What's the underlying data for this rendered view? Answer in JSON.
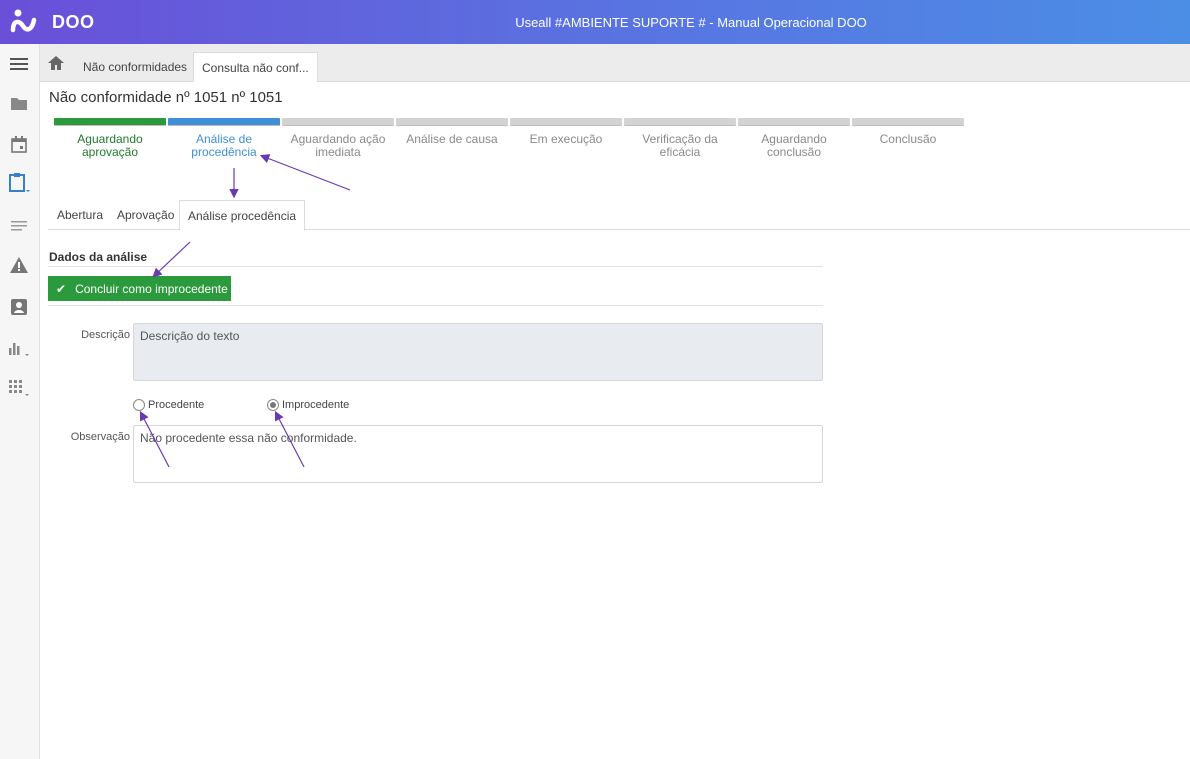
{
  "header": {
    "logo_text": "DOO",
    "title": "Useall #AMBIENTE SUPORTE # - Manual Operacional DOO"
  },
  "sidebar": {
    "icons": [
      "menu-icon",
      "folder-icon",
      "calendar-icon",
      "clipboard-icon",
      "list-icon",
      "warning-icon",
      "contact-icon",
      "bar-chart-icon",
      "grid-icon"
    ]
  },
  "breadcrumb": {
    "tab1": "Não conformidades",
    "tab2": "Consulta não conf..."
  },
  "page": {
    "title": "Não conformidade nº 1051 nº 1051"
  },
  "steps": [
    {
      "label_line1": "Aguardando",
      "label_line2": "aprovação",
      "state": "done"
    },
    {
      "label_line1": "Análise de",
      "label_line2": "procedência",
      "state": "current"
    },
    {
      "label_line1": "Aguardando ação",
      "label_line2": "imediata",
      "state": "pending"
    },
    {
      "label_line1": "Análise de causa",
      "label_line2": "",
      "state": "pending"
    },
    {
      "label_line1": "Em execução",
      "label_line2": "",
      "state": "pending"
    },
    {
      "label_line1": "Verificação da eficácia",
      "label_line2": "",
      "state": "pending"
    },
    {
      "label_line1": "Aguardando",
      "label_line2": "conclusão",
      "state": "pending"
    },
    {
      "label_line1": "Conclusão",
      "label_line2": "",
      "state": "pending"
    }
  ],
  "tabs": {
    "abertura": "Abertura",
    "aprovacao": "Aprovação",
    "analise": "Análise procedência"
  },
  "section": {
    "title": "Dados da análise"
  },
  "actions": {
    "conclude_label": "Concluir como improcedente"
  },
  "form": {
    "descricao_label": "Descrição",
    "descricao_value": "Descrição do texto",
    "radio_procedente": "Procedente",
    "radio_improcedente": "Improcedente",
    "selected": "Improcedente",
    "observacao_label": "Observação",
    "observacao_value": "Não procedente essa não conformidade."
  },
  "colors": {
    "accent_green": "#2a9a3c",
    "accent_blue": "#3f8ed8",
    "arrow": "#6a3bb0"
  }
}
